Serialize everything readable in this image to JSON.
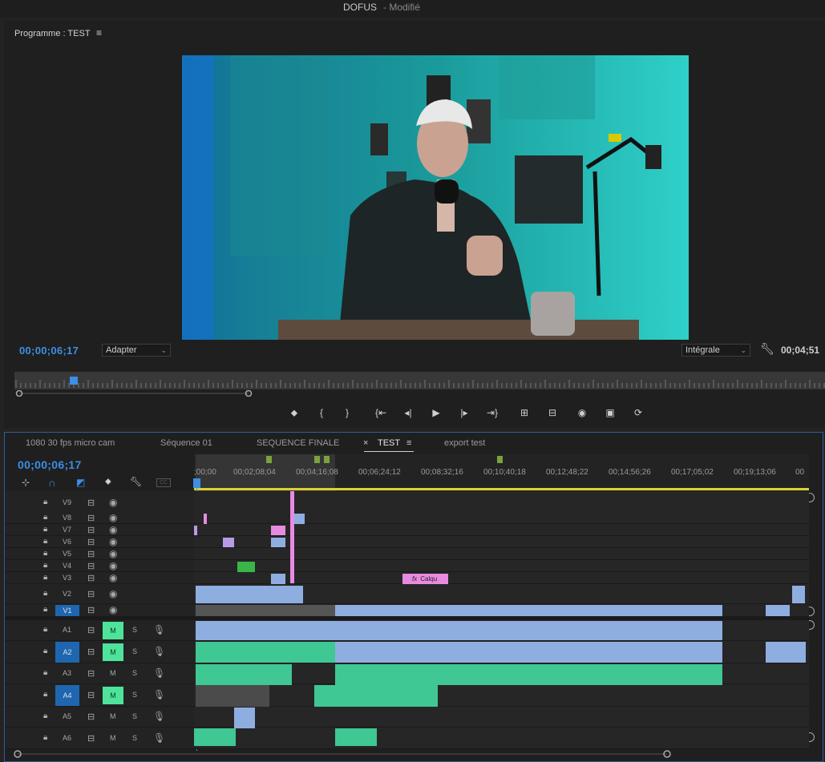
{
  "window": {
    "project_name": "DOFUS",
    "status": "- Modifié"
  },
  "monitor": {
    "title": "Programme : TEST",
    "menu_icon": "≡",
    "timecode_current": "00;00;06;17",
    "timecode_duration": "00;04;51",
    "zoom_select": "Adapter",
    "resolution_select": "Intégrale",
    "playhead_progress": 0.068,
    "transport": [
      {
        "name": "marker-icon",
        "glyph": "⬥"
      },
      {
        "name": "mark-in-icon",
        "glyph": "{"
      },
      {
        "name": "mark-out-icon",
        "glyph": "}"
      },
      {
        "name": "go-to-in-icon",
        "glyph": "{⇤"
      },
      {
        "name": "step-back-icon",
        "glyph": "◂|"
      },
      {
        "name": "play-icon",
        "glyph": "▶"
      },
      {
        "name": "step-forward-icon",
        "glyph": "|▸"
      },
      {
        "name": "go-to-out-icon",
        "glyph": "⇥}"
      },
      {
        "name": "lift-icon",
        "glyph": "⊞"
      },
      {
        "name": "extract-icon",
        "glyph": "⊟"
      },
      {
        "name": "export-frame-icon",
        "glyph": "◉"
      },
      {
        "name": "compare-view-icon",
        "glyph": "▣"
      },
      {
        "name": "vr-toggle-icon",
        "glyph": "⟳"
      }
    ]
  },
  "timeline": {
    "tabs": [
      {
        "label": "1080 30 fps micro cam",
        "active": false
      },
      {
        "label": "Séquence 01",
        "active": false
      },
      {
        "label": "SEQUENCE FINALE",
        "active": false
      },
      {
        "label": "TEST",
        "active": true
      },
      {
        "label": "export test",
        "active": false
      }
    ],
    "tab_close": "×",
    "tab_menu": "≡",
    "timecode": "00;00;06;17",
    "ruler_ticks": [
      ";00;00",
      "00;02;08;04",
      "00;04;16;08",
      "00;06;24;12",
      "00;08;32;16",
      "00;10;40;18",
      "00;12;48;22",
      "00;14;56;26",
      "00;17;05;02",
      "00;19;13;06",
      "00"
    ],
    "video_tracks": [
      "V9",
      "V8",
      "V7",
      "V6",
      "V5",
      "V4",
      "V3",
      "V2",
      "V1"
    ],
    "audio_tracks": [
      "A1",
      "A2",
      "A3",
      "A4",
      "A5",
      "A6"
    ],
    "mute_label": "M",
    "solo_label": "S",
    "title_clip_label": "Calqu",
    "fx_badge": "fx",
    "colors": {
      "accent": "#3b8fe6",
      "video_clip": "#8faee0",
      "audio_clip": "#3fc794",
      "mute_on": "#4ee39a",
      "title_clip": "#e78be0",
      "adjust_clip": "#b89ae6"
    }
  }
}
